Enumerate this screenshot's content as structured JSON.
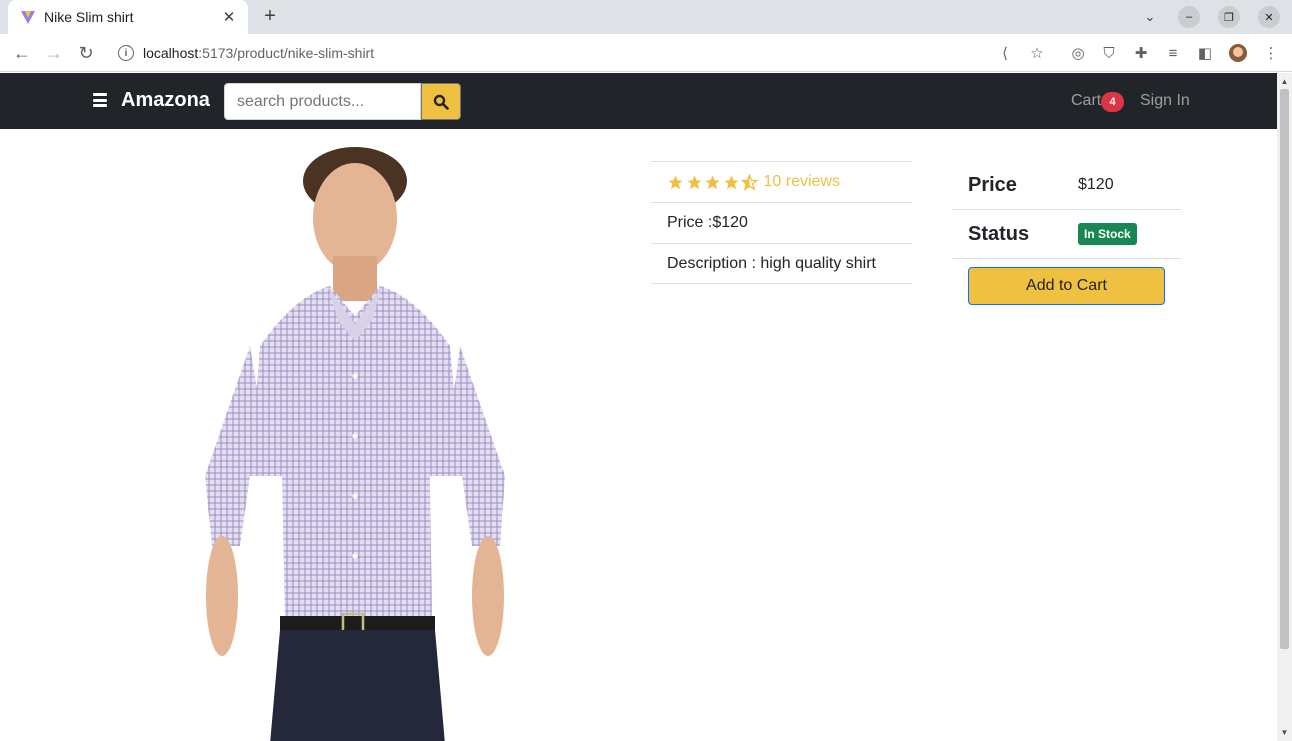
{
  "browser": {
    "tab_title": "Nike Slim shirt",
    "url_host": "localhost",
    "url_path": ":5173/product/nike-slim-shirt"
  },
  "navbar": {
    "brand": "Amazona",
    "search_placeholder": "search products...",
    "cart_label": "Cart",
    "cart_count": "4",
    "signin_label": "Sign In",
    "accent_color": "#f0c040",
    "background_color": "#212529"
  },
  "product": {
    "rating": 4.5,
    "reviews_label": "10 reviews",
    "price_line": "Price :$120",
    "description_line": "Description : high quality shirt"
  },
  "side": {
    "price_label": "Price",
    "price_value": "$120",
    "status_label": "Status",
    "status_value": "In Stock",
    "add_to_cart": "Add to Cart"
  }
}
